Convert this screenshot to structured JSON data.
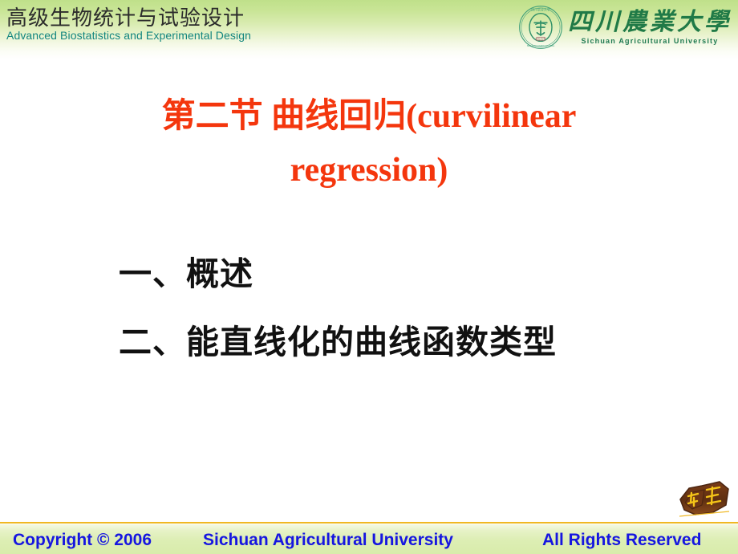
{
  "header": {
    "title_cn": "高级生物统计与试验设计",
    "title_en": "Advanced Biostatistics and Experimental Design",
    "logo": {
      "emblem_name": "sichuan-agricultural-university-emblem",
      "wordmark_cn": "四川農業大學",
      "wordmark_en": "Sichuan Agricultural University"
    },
    "colors": {
      "gradient_top": "#bfe08a",
      "gradient_bottom": "#ffffff",
      "title_cn_color": "#2c2c2c",
      "title_en_color": "#12857e",
      "logo_color": "#207a47"
    }
  },
  "main": {
    "title_line1": "第二节  曲线回归(curvilinear",
    "title_line2": "regression)",
    "title_color": "#f4360d",
    "outline": [
      {
        "label": "一、概述"
      },
      {
        "label": "二、能直线化的曲线函数类型"
      }
    ],
    "outline_color": "#111111"
  },
  "return_button": {
    "label": "返回",
    "name": "return-button",
    "body_color": "#6b3416",
    "accent_color": "#f5c518"
  },
  "footer": {
    "copyright": "Copyright © 2006",
    "organization": "Sichuan Agricultural University",
    "rights": "All Rights Reserved",
    "text_color": "#1616e0",
    "rule_color": "#f0b823",
    "background_color": "#d8ecab"
  }
}
